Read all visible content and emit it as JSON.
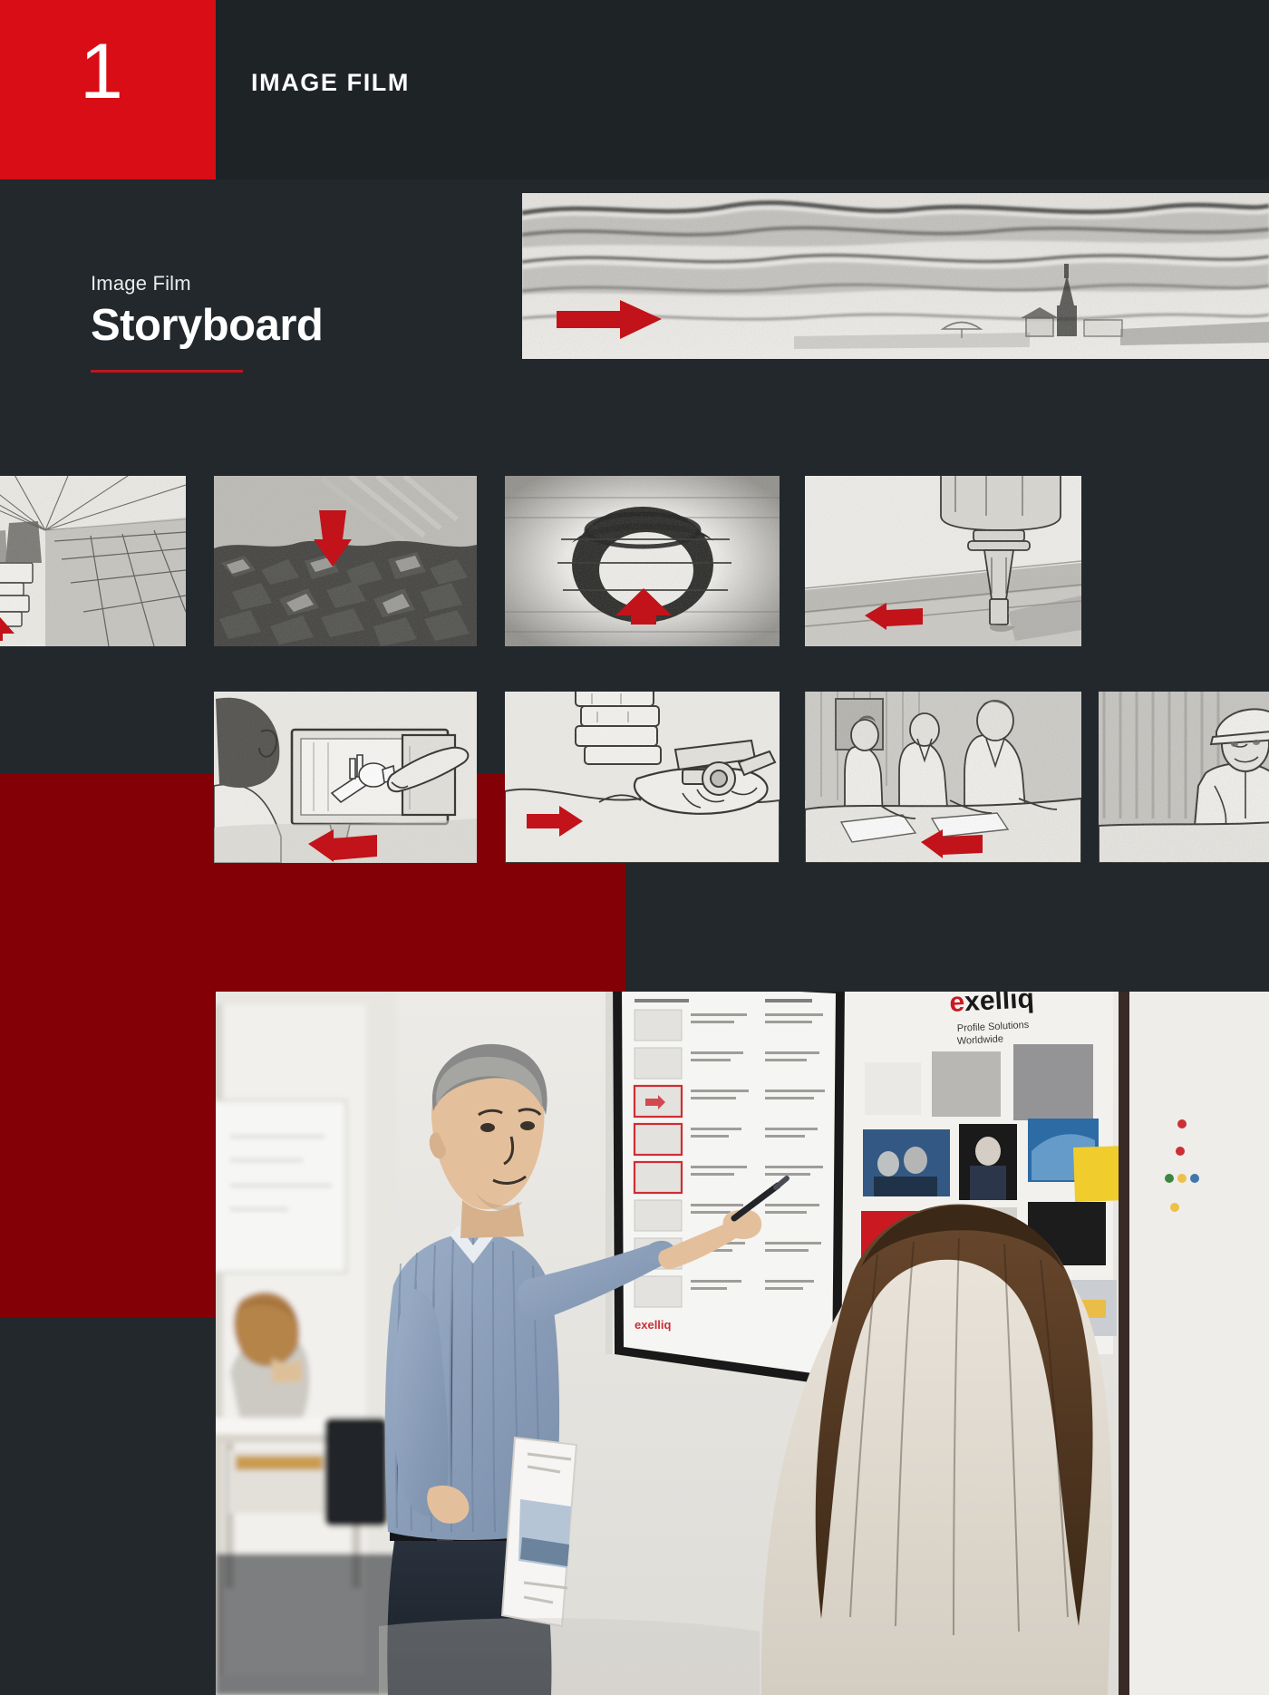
{
  "header": {
    "number": "1",
    "title": "IMAGE FILM",
    "number_tile_color": "#d80d15",
    "bar_color": "#1e2326"
  },
  "title_block": {
    "eyebrow": "Image Film",
    "title": "Storyboard",
    "rule_color": "#c0151c"
  },
  "palette": {
    "page_background": "#22282b",
    "accent_red": "#d80d15",
    "deep_red": "#820006",
    "sketch_paper": "#e9e7e2",
    "arrow_red": "#c11319"
  },
  "panorama": {
    "name": "panorama-landscape-frame",
    "caption": "Wide charcoal landscape panorama with church spire and village",
    "arrow": "right"
  },
  "storyboard_rows": [
    {
      "row": 1,
      "frames": [
        {
          "id": "frame-1",
          "caption": "Extrusion press hall in perspective",
          "arrow": "up"
        },
        {
          "id": "frame-2",
          "caption": "Crushed aluminium scrap field",
          "arrow": "down"
        },
        {
          "id": "frame-3",
          "caption": "Extrusion die cross section",
          "arrow": "up"
        },
        {
          "id": "frame-4",
          "caption": "CNC spindle machining a profile",
          "arrow": "left"
        }
      ]
    },
    {
      "row": 2,
      "frames": [
        {
          "id": "frame-5",
          "caption": "Engineer at CAD monitor with 3D part",
          "arrow": "left"
        },
        {
          "id": "frame-6",
          "caption": "Caliper measuring a machined part",
          "arrow": "right"
        },
        {
          "id": "frame-7",
          "caption": "Team meeting reviewing drawings",
          "arrow": "left"
        },
        {
          "id": "frame-8",
          "caption": "Worker in hard hat at production line",
          "arrow": "none"
        }
      ]
    }
  ],
  "photo": {
    "name": "storyboard-review-photo",
    "caption": "Two colleagues reviewing a printed storyboard pinned to a wall board",
    "board_logo": "exelliq",
    "board_tagline_line1": "Profile Solutions",
    "board_tagline_line2": "Worldwide"
  }
}
